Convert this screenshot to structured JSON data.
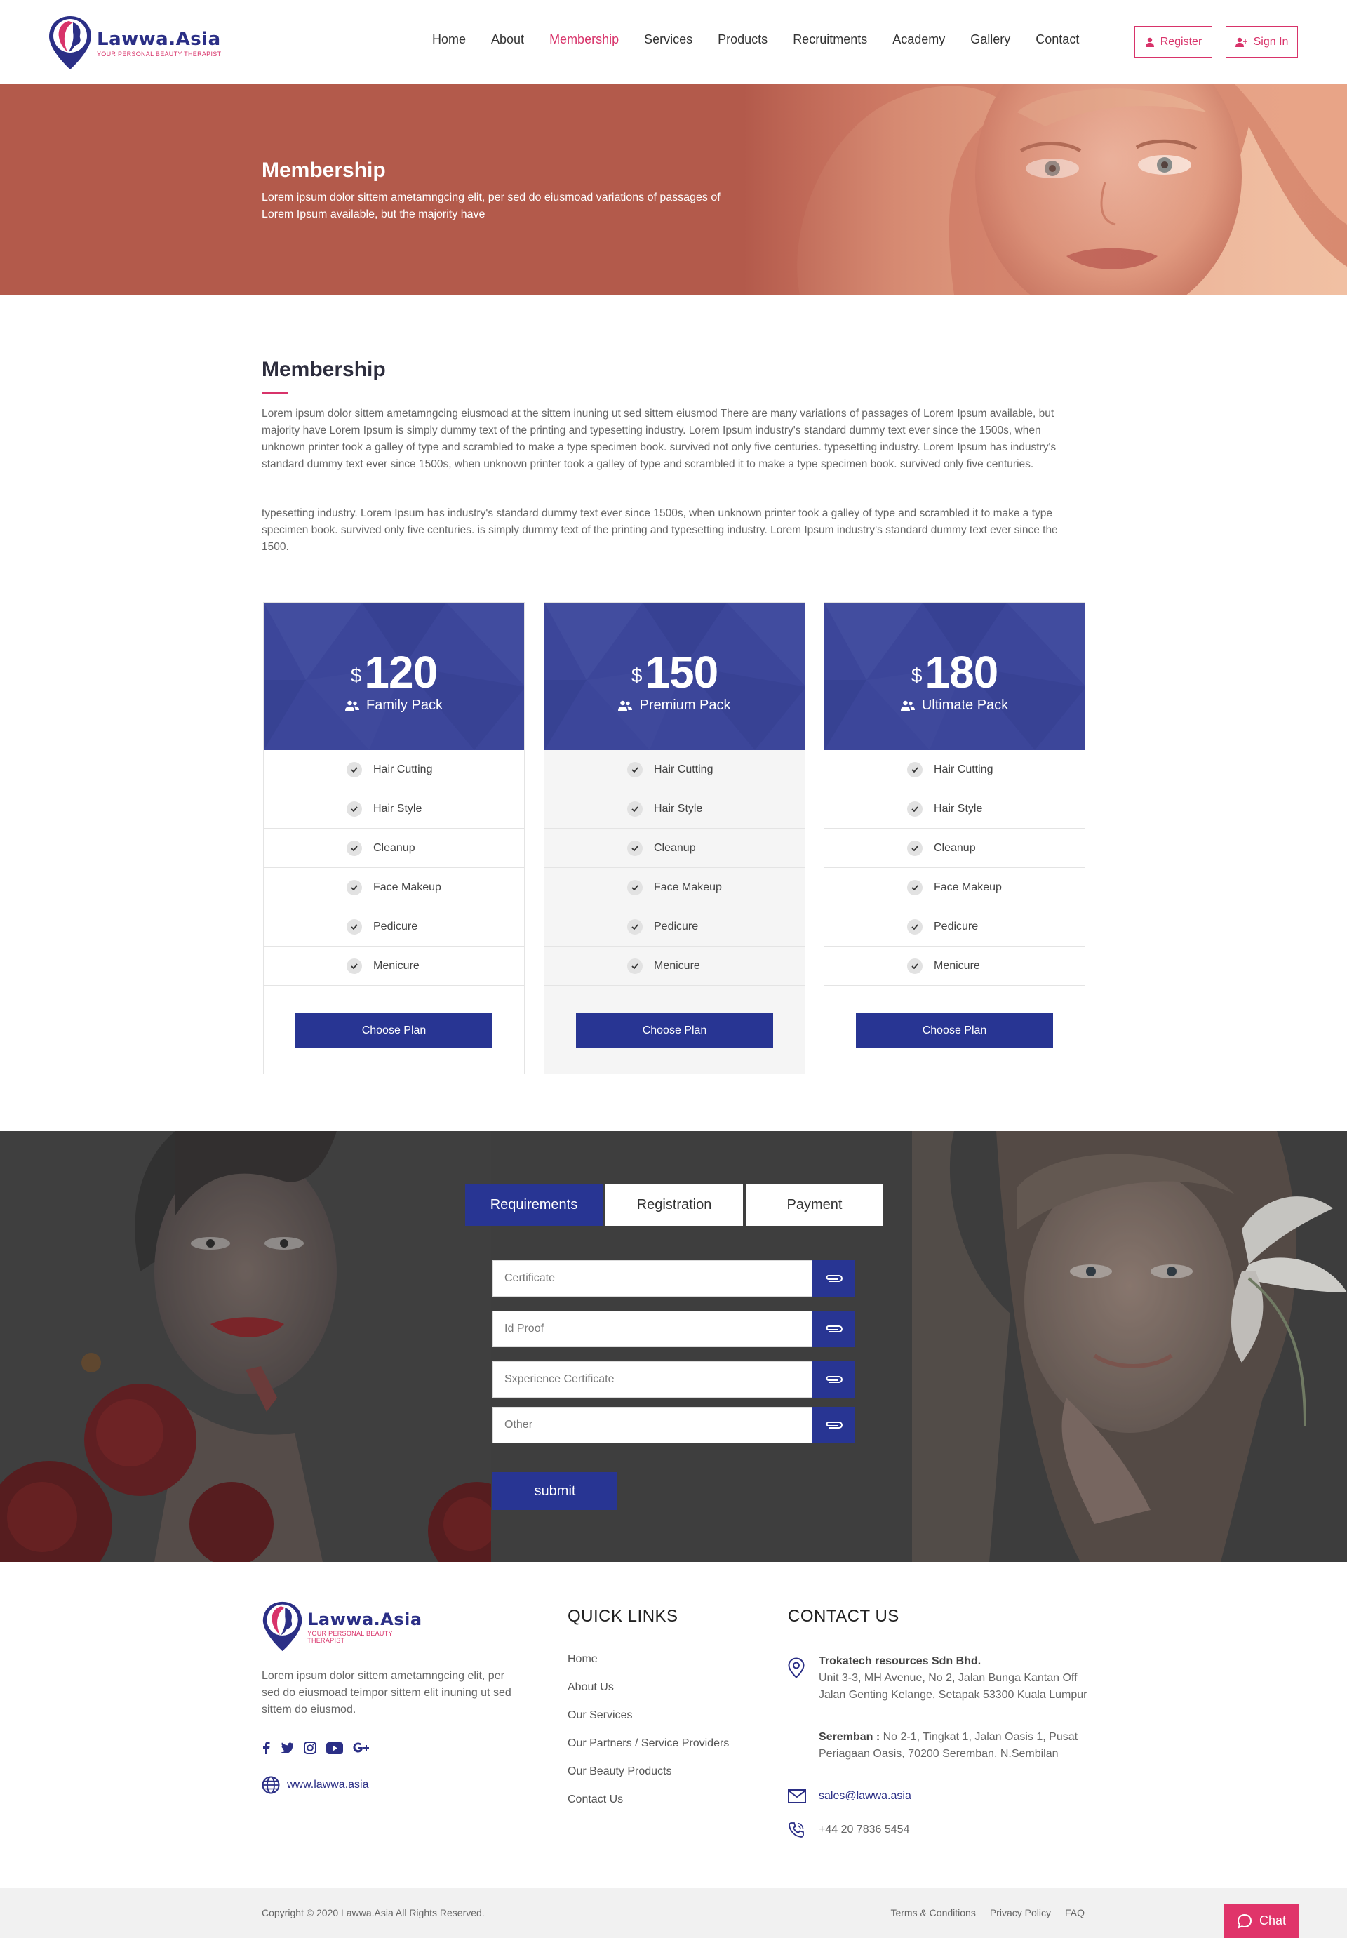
{
  "brand": {
    "name": "Lawwa.Asia",
    "tagline": "YOUR PERSONAL BEAUTY THERAPIST",
    "primary_color": "#283593",
    "accent_color": "#d8336a"
  },
  "nav": {
    "items": [
      "Home",
      "About",
      "Membership",
      "Services",
      "Products",
      "Recruitments",
      "Academy",
      "Gallery",
      "Contact"
    ],
    "active": "Membership",
    "register_label": "Register",
    "signin_label": "Sign In"
  },
  "hero": {
    "title": "Membership",
    "subtitle": "Lorem ipsum dolor sittem ametamngcing elit, per sed do eiusmoad variations of passages of Lorem Ipsum available, but the majority have"
  },
  "intro": {
    "title": "Membership",
    "para1": "Lorem ipsum dolor sittem ametamngcing eiusmoad at the sittem inuning ut sed sittem eiusmod There are many variations of passages of Lorem Ipsum available, but majority have Lorem Ipsum is simply dummy text of the printing and typesetting industry. Lorem Ipsum industry's standard dummy text ever since the 1500s, when unknown printer took a galley of type and scrambled to make a type specimen book. survived not only five centuries. typesetting industry. Lorem Ipsum has industry's standard dummy text ever since 1500s, when unknown printer took a galley of type and scrambled it to make a type specimen book. survived only five centuries.",
    "para2": "typesetting industry. Lorem Ipsum has industry's standard dummy text ever since 1500s, when unknown printer took a galley of type and scrambled it to make a type specimen book. survived only five centuries. is simply dummy text of the printing and typesetting industry. Lorem Ipsum industry's standard dummy text ever since the 1500."
  },
  "plans": [
    {
      "currency": "$",
      "price": "120",
      "name": "Family Pack",
      "features": [
        "Hair Cutting",
        "Hair Style",
        "Cleanup",
        "Face Makeup",
        "Pedicure",
        "Menicure"
      ],
      "button": "Choose Plan"
    },
    {
      "currency": "$",
      "price": "150",
      "name": "Premium Pack",
      "features": [
        "Hair Cutting",
        "Hair Style",
        "Cleanup",
        "Face Makeup",
        "Pedicure",
        "Menicure"
      ],
      "button": "Choose Plan"
    },
    {
      "currency": "$",
      "price": "180",
      "name": "Ultimate Pack",
      "features": [
        "Hair Cutting",
        "Hair Style",
        "Cleanup",
        "Face Makeup",
        "Pedicure",
        "Menicure"
      ],
      "button": "Choose Plan"
    }
  ],
  "form": {
    "tabs": [
      "Requirements",
      "Registration",
      "Payment"
    ],
    "active_tab": "Requirements",
    "fields": [
      "Certificate",
      "Id Proof",
      "Sxperience Certificate",
      "Other"
    ],
    "submit": "submit"
  },
  "footer": {
    "about": "Lorem ipsum dolor sittem ametamngcing elit, per sed do eiusmoad teimpor sittem elit inuning ut sed sittem do eiusmod.",
    "website": "www.lawwa.asia",
    "socials": [
      "facebook-icon",
      "twitter-icon",
      "instagram-icon",
      "youtube-icon",
      "google-plus-icon"
    ],
    "quick_links_title": "QUICK LINKS",
    "quick_links": [
      "Home",
      "About Us",
      "Our Services",
      "Our Partners / Service Providers",
      "Our Beauty Products",
      "Contact Us"
    ],
    "contact_title": "CONTACT US",
    "company": "Trokatech resources Sdn Bhd.",
    "address": "Unit 3-3, MH Avenue, No 2, Jalan Bunga Kantan Off Jalan Genting Kelange, Setapak 53300 Kuala Lumpur",
    "branch_label": "Seremban :",
    "branch_address": "No 2-1, Tingkat 1, Jalan Oasis 1, Pusat Periagaan Oasis, 70200 Seremban, N.Sembilan",
    "email": "sales@lawwa.asia",
    "phone": "+44 20 7836 5454"
  },
  "bottom": {
    "copyright": "Copyright © 2020 Lawwa.Asia All Rights Reserved.",
    "links": [
      "Terms & Conditions",
      "Privacy Policy",
      "FAQ"
    ],
    "chat": "Chat"
  }
}
